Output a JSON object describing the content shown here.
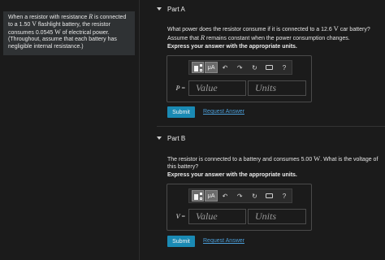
{
  "problem": {
    "segments": [
      {
        "t": "When a resistor with resistance ",
        "k": "text"
      },
      {
        "t": "R",
        "k": "var"
      },
      {
        "t": " is connected to a 1.50 ",
        "k": "text"
      },
      {
        "t": "V",
        "k": "unit"
      },
      {
        "t": " flashlight battery, the resistor consumes 0.0545 ",
        "k": "text"
      },
      {
        "t": "W",
        "k": "unit"
      },
      {
        "t": " of electrical power. (Throughout, assume that each battery has negligible internal resistance.)",
        "k": "text"
      }
    ]
  },
  "parts": [
    {
      "title": "Part A",
      "question": [
        {
          "t": "What power does the resistor consume if it is connected to a 12.6 ",
          "k": "text"
        },
        {
          "t": "V",
          "k": "unit"
        },
        {
          "t": " car battery? Assume that ",
          "k": "text"
        },
        {
          "t": "R",
          "k": "var"
        },
        {
          "t": " remains constant when the power consumption changes.",
          "k": "text"
        }
      ],
      "instruction": "Express your answer with the appropriate units.",
      "toolbar": {
        "mu": "μA",
        "undo": "↶",
        "redo": "↷",
        "reset": "↻",
        "help": "?"
      },
      "var_symbol": "P",
      "eq": " =",
      "value_placeholder": "Value",
      "units_placeholder": "Units",
      "submit": "Submit",
      "request": "Request Answer"
    },
    {
      "title": "Part B",
      "question": [
        {
          "t": "The resistor is connected to a battery and consumes 5.00 ",
          "k": "text"
        },
        {
          "t": "W",
          "k": "unit"
        },
        {
          "t": ". What is the voltage of this battery?",
          "k": "text"
        }
      ],
      "instruction": "Express your answer with the appropriate units.",
      "toolbar": {
        "mu": "μA",
        "undo": "↶",
        "redo": "↷",
        "reset": "↻",
        "help": "?"
      },
      "var_symbol": "V",
      "eq": " =",
      "value_placeholder": "Value",
      "units_placeholder": "Units",
      "submit": "Submit",
      "request": "Request Answer"
    }
  ]
}
